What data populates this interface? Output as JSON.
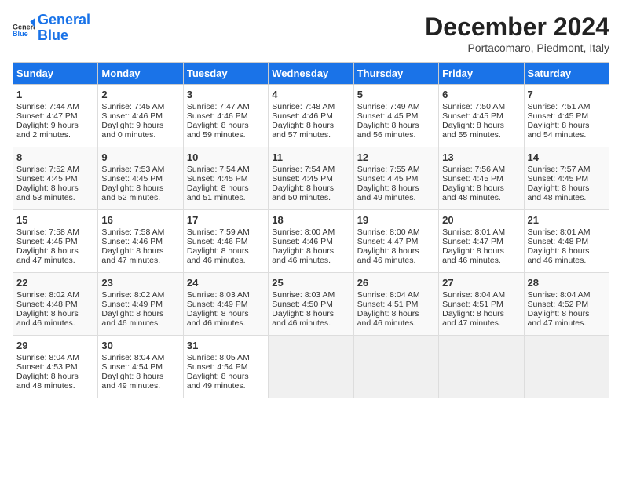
{
  "header": {
    "logo_line1": "General",
    "logo_line2": "Blue",
    "month": "December 2024",
    "location": "Portacomaro, Piedmont, Italy"
  },
  "days_of_week": [
    "Sunday",
    "Monday",
    "Tuesday",
    "Wednesday",
    "Thursday",
    "Friday",
    "Saturday"
  ],
  "weeks": [
    [
      {
        "day": "1",
        "lines": [
          "Sunrise: 7:44 AM",
          "Sunset: 4:47 PM",
          "Daylight: 9 hours",
          "and 2 minutes."
        ]
      },
      {
        "day": "2",
        "lines": [
          "Sunrise: 7:45 AM",
          "Sunset: 4:46 PM",
          "Daylight: 9 hours",
          "and 0 minutes."
        ]
      },
      {
        "day": "3",
        "lines": [
          "Sunrise: 7:47 AM",
          "Sunset: 4:46 PM",
          "Daylight: 8 hours",
          "and 59 minutes."
        ]
      },
      {
        "day": "4",
        "lines": [
          "Sunrise: 7:48 AM",
          "Sunset: 4:46 PM",
          "Daylight: 8 hours",
          "and 57 minutes."
        ]
      },
      {
        "day": "5",
        "lines": [
          "Sunrise: 7:49 AM",
          "Sunset: 4:45 PM",
          "Daylight: 8 hours",
          "and 56 minutes."
        ]
      },
      {
        "day": "6",
        "lines": [
          "Sunrise: 7:50 AM",
          "Sunset: 4:45 PM",
          "Daylight: 8 hours",
          "and 55 minutes."
        ]
      },
      {
        "day": "7",
        "lines": [
          "Sunrise: 7:51 AM",
          "Sunset: 4:45 PM",
          "Daylight: 8 hours",
          "and 54 minutes."
        ]
      }
    ],
    [
      {
        "day": "8",
        "lines": [
          "Sunrise: 7:52 AM",
          "Sunset: 4:45 PM",
          "Daylight: 8 hours",
          "and 53 minutes."
        ]
      },
      {
        "day": "9",
        "lines": [
          "Sunrise: 7:53 AM",
          "Sunset: 4:45 PM",
          "Daylight: 8 hours",
          "and 52 minutes."
        ]
      },
      {
        "day": "10",
        "lines": [
          "Sunrise: 7:54 AM",
          "Sunset: 4:45 PM",
          "Daylight: 8 hours",
          "and 51 minutes."
        ]
      },
      {
        "day": "11",
        "lines": [
          "Sunrise: 7:54 AM",
          "Sunset: 4:45 PM",
          "Daylight: 8 hours",
          "and 50 minutes."
        ]
      },
      {
        "day": "12",
        "lines": [
          "Sunrise: 7:55 AM",
          "Sunset: 4:45 PM",
          "Daylight: 8 hours",
          "and 49 minutes."
        ]
      },
      {
        "day": "13",
        "lines": [
          "Sunrise: 7:56 AM",
          "Sunset: 4:45 PM",
          "Daylight: 8 hours",
          "and 48 minutes."
        ]
      },
      {
        "day": "14",
        "lines": [
          "Sunrise: 7:57 AM",
          "Sunset: 4:45 PM",
          "Daylight: 8 hours",
          "and 48 minutes."
        ]
      }
    ],
    [
      {
        "day": "15",
        "lines": [
          "Sunrise: 7:58 AM",
          "Sunset: 4:45 PM",
          "Daylight: 8 hours",
          "and 47 minutes."
        ]
      },
      {
        "day": "16",
        "lines": [
          "Sunrise: 7:58 AM",
          "Sunset: 4:46 PM",
          "Daylight: 8 hours",
          "and 47 minutes."
        ]
      },
      {
        "day": "17",
        "lines": [
          "Sunrise: 7:59 AM",
          "Sunset: 4:46 PM",
          "Daylight: 8 hours",
          "and 46 minutes."
        ]
      },
      {
        "day": "18",
        "lines": [
          "Sunrise: 8:00 AM",
          "Sunset: 4:46 PM",
          "Daylight: 8 hours",
          "and 46 minutes."
        ]
      },
      {
        "day": "19",
        "lines": [
          "Sunrise: 8:00 AM",
          "Sunset: 4:47 PM",
          "Daylight: 8 hours",
          "and 46 minutes."
        ]
      },
      {
        "day": "20",
        "lines": [
          "Sunrise: 8:01 AM",
          "Sunset: 4:47 PM",
          "Daylight: 8 hours",
          "and 46 minutes."
        ]
      },
      {
        "day": "21",
        "lines": [
          "Sunrise: 8:01 AM",
          "Sunset: 4:48 PM",
          "Daylight: 8 hours",
          "and 46 minutes."
        ]
      }
    ],
    [
      {
        "day": "22",
        "lines": [
          "Sunrise: 8:02 AM",
          "Sunset: 4:48 PM",
          "Daylight: 8 hours",
          "and 46 minutes."
        ]
      },
      {
        "day": "23",
        "lines": [
          "Sunrise: 8:02 AM",
          "Sunset: 4:49 PM",
          "Daylight: 8 hours",
          "and 46 minutes."
        ]
      },
      {
        "day": "24",
        "lines": [
          "Sunrise: 8:03 AM",
          "Sunset: 4:49 PM",
          "Daylight: 8 hours",
          "and 46 minutes."
        ]
      },
      {
        "day": "25",
        "lines": [
          "Sunrise: 8:03 AM",
          "Sunset: 4:50 PM",
          "Daylight: 8 hours",
          "and 46 minutes."
        ]
      },
      {
        "day": "26",
        "lines": [
          "Sunrise: 8:04 AM",
          "Sunset: 4:51 PM",
          "Daylight: 8 hours",
          "and 46 minutes."
        ]
      },
      {
        "day": "27",
        "lines": [
          "Sunrise: 8:04 AM",
          "Sunset: 4:51 PM",
          "Daylight: 8 hours",
          "and 47 minutes."
        ]
      },
      {
        "day": "28",
        "lines": [
          "Sunrise: 8:04 AM",
          "Sunset: 4:52 PM",
          "Daylight: 8 hours",
          "and 47 minutes."
        ]
      }
    ],
    [
      {
        "day": "29",
        "lines": [
          "Sunrise: 8:04 AM",
          "Sunset: 4:53 PM",
          "Daylight: 8 hours",
          "and 48 minutes."
        ]
      },
      {
        "day": "30",
        "lines": [
          "Sunrise: 8:04 AM",
          "Sunset: 4:54 PM",
          "Daylight: 8 hours",
          "and 49 minutes."
        ]
      },
      {
        "day": "31",
        "lines": [
          "Sunrise: 8:05 AM",
          "Sunset: 4:54 PM",
          "Daylight: 8 hours",
          "and 49 minutes."
        ]
      },
      null,
      null,
      null,
      null
    ]
  ]
}
